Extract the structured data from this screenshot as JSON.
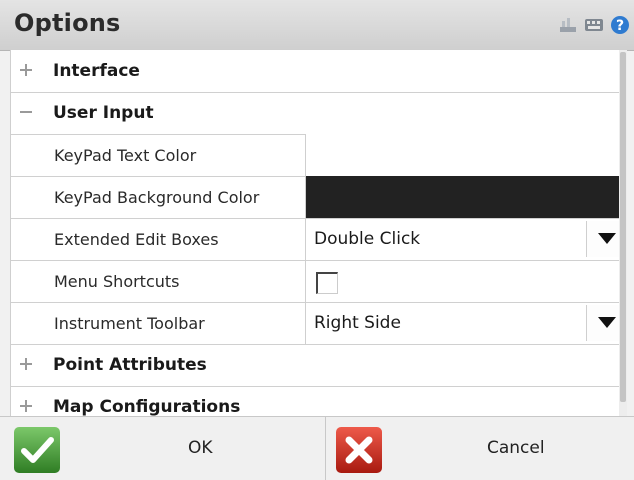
{
  "window": {
    "title": "Options"
  },
  "titlebar_icons": [
    "taskbar-icon",
    "keyboard-icon",
    "help-icon"
  ],
  "categories": [
    {
      "label": "Interface",
      "expanded": false
    },
    {
      "label": "User Input",
      "expanded": true
    },
    {
      "label": "Point Attributes",
      "expanded": false
    },
    {
      "label": "Map Configurations",
      "expanded": false
    }
  ],
  "properties": [
    {
      "name": "KeyPad Text Color",
      "value": "",
      "color": "#ffffff"
    },
    {
      "name": "KeyPad Background Color",
      "value": "",
      "color": "#222222"
    },
    {
      "name": "Extended Edit Boxes",
      "value": "Double Click"
    },
    {
      "name": "Menu Shortcuts",
      "checked": false
    },
    {
      "name": "Instrument Toolbar",
      "value": "Right Side"
    }
  ],
  "buttons": {
    "ok_label": "OK",
    "cancel_label": "Cancel"
  },
  "colors": {
    "ok_green": "#3a8f2e",
    "cancel_red": "#c5281c",
    "keypad_background": "#222222"
  }
}
